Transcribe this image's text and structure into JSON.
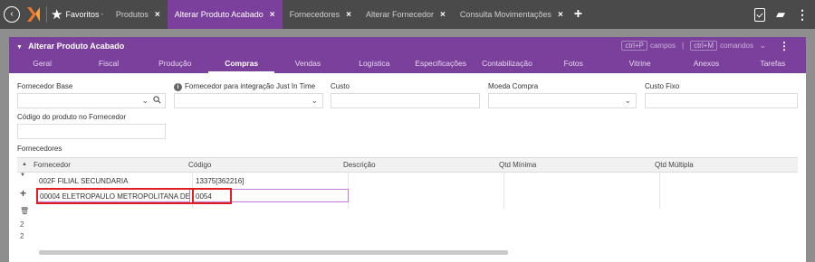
{
  "topbar": {
    "favorites_label": "Favoritos",
    "tabs": [
      {
        "label": "Produtos",
        "active": false
      },
      {
        "label": "Alterar Produto Acabado",
        "active": true
      },
      {
        "label": "Fornecedores",
        "active": false
      },
      {
        "label": "Alterar Fornecedor",
        "active": false
      },
      {
        "label": "Consulta Movimentações",
        "active": false
      }
    ],
    "close_glyph": "×",
    "add_tab_glyph": "+"
  },
  "panel": {
    "title": "Alterar Produto Acabado",
    "shortcut1_key": "ctrl+P",
    "shortcut1_label": "campos",
    "shortcut_sep": "|",
    "shortcut2_key": "ctrl+M",
    "shortcut2_label": "comandos",
    "nav_tabs": [
      "Geral",
      "Fiscal",
      "Produção",
      "Compras",
      "Vendas",
      "Logística",
      "Especificações",
      "Contabilização",
      "Fotos",
      "Vitrine",
      "Anexos",
      "Tarefas"
    ],
    "active_tab": "Compras"
  },
  "form": {
    "fornecedor_base": {
      "label": "Fornecedor Base",
      "value": ""
    },
    "fornecedor_jit": {
      "label": "Fornecedor para integração Just In Time",
      "value": ""
    },
    "custo": {
      "label": "Custo",
      "value": ""
    },
    "moeda_compra": {
      "label": "Moeda Compra",
      "value": ""
    },
    "custo_fixo": {
      "label": "Custo Fixo",
      "value": ""
    },
    "codigo_fornecedor": {
      "label": "Código do produto no Fornecedor",
      "value": ""
    }
  },
  "grid": {
    "section_label": "Fornecedores",
    "columns": [
      "Fornecedor",
      "Código",
      "Descrição",
      "Qtd Mínima",
      "Qtd Múltipla"
    ],
    "rows": [
      {
        "fornecedor": "002F FILIAL SECUNDARIA",
        "codigo": "13375[362216]",
        "descricao": "",
        "qtd_minima": "",
        "qtd_multipla": ""
      },
      {
        "fornecedor": "00004 ELETROPAULO METROPOLITANA DE S...",
        "codigo": "0054",
        "descricao": "",
        "qtd_minima": "",
        "qtd_multipla": ""
      }
    ],
    "row_counter_1": "2",
    "row_counter_2": "2"
  },
  "colors": {
    "topbar_bg": "#4a4a4a",
    "accent_purple": "#7b3f9c",
    "highlight_red": "#e02020",
    "background_gray": "#8e8e8e"
  }
}
